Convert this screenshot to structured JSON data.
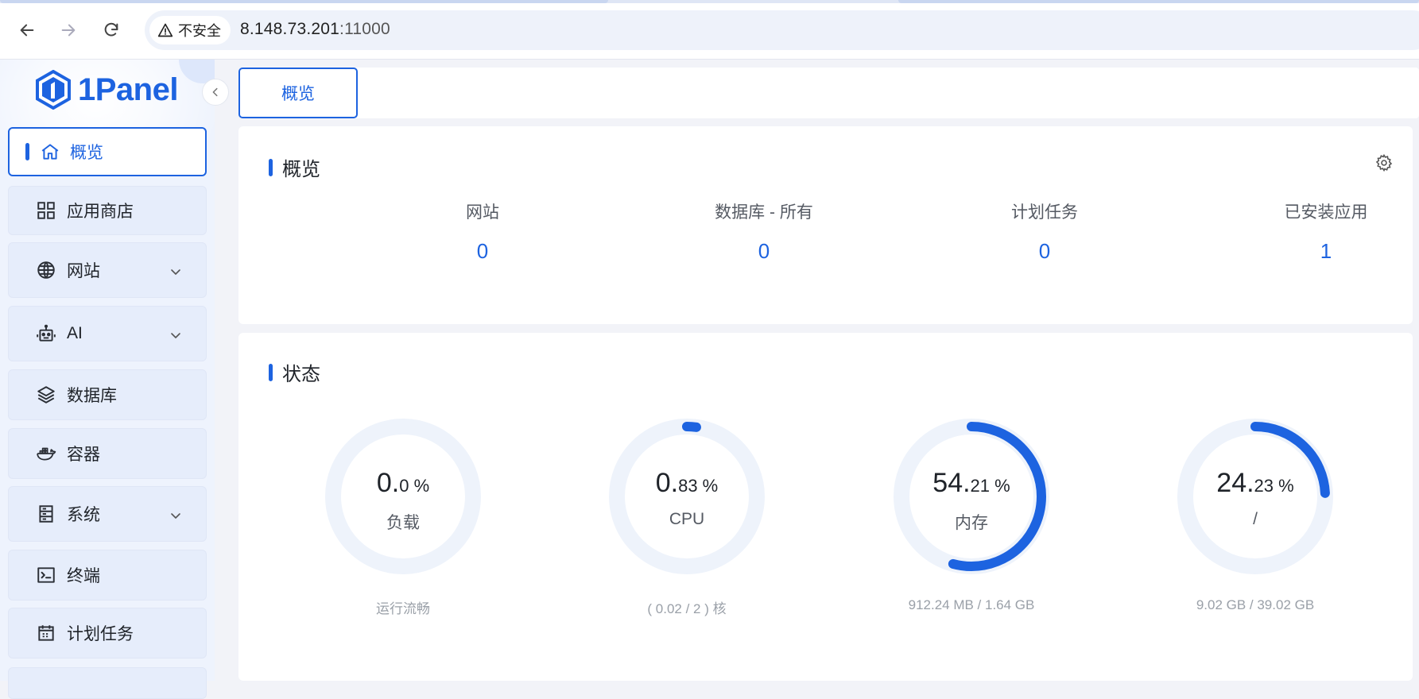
{
  "browser": {
    "security_label": "不安全",
    "url_host": "8.148.73.201",
    "url_port": ":11000"
  },
  "sidebar": {
    "logo_text": "1Panel",
    "items": [
      {
        "label": "概览",
        "icon": "home-icon",
        "active": true,
        "expandable": false
      },
      {
        "label": "应用商店",
        "icon": "grid-icon",
        "active": false,
        "expandable": false
      },
      {
        "label": "网站",
        "icon": "globe-icon",
        "active": false,
        "expandable": true
      },
      {
        "label": "AI",
        "icon": "robot-icon",
        "active": false,
        "expandable": true
      },
      {
        "label": "数据库",
        "icon": "layers-icon",
        "active": false,
        "expandable": false
      },
      {
        "label": "容器",
        "icon": "docker-icon",
        "active": false,
        "expandable": false
      },
      {
        "label": "系统",
        "icon": "server-icon",
        "active": false,
        "expandable": true
      },
      {
        "label": "终端",
        "icon": "terminal-icon",
        "active": false,
        "expandable": false
      },
      {
        "label": "计划任务",
        "icon": "calendar-icon",
        "active": false,
        "expandable": false
      }
    ]
  },
  "tabs": {
    "overview_label": "概览"
  },
  "overview": {
    "title": "概览",
    "stats": [
      {
        "label": "网站",
        "value": "0"
      },
      {
        "label": "数据库 - 所有",
        "value": "0"
      },
      {
        "label": "计划任务",
        "value": "0"
      },
      {
        "label": "已安装应用",
        "value": "1"
      }
    ]
  },
  "status": {
    "title": "状态",
    "gauges": [
      {
        "int": "0.",
        "dec": "0 %",
        "percent": 0.0,
        "name": "负载",
        "sub": "运行流畅"
      },
      {
        "int": "0.",
        "dec": "83 %",
        "percent": 0.83,
        "name": "CPU",
        "sub": "( 0.02 / 2 ) 核"
      },
      {
        "int": "54.",
        "dec": "21 %",
        "percent": 54.21,
        "name": "内存",
        "sub": "912.24 MB / 1.64 GB"
      },
      {
        "int": "24.",
        "dec": "23 %",
        "percent": 24.23,
        "name": "/",
        "sub": "9.02 GB / 39.02 GB"
      }
    ]
  },
  "colors": {
    "accent": "#1d63e0",
    "track": "#eef3fb"
  }
}
